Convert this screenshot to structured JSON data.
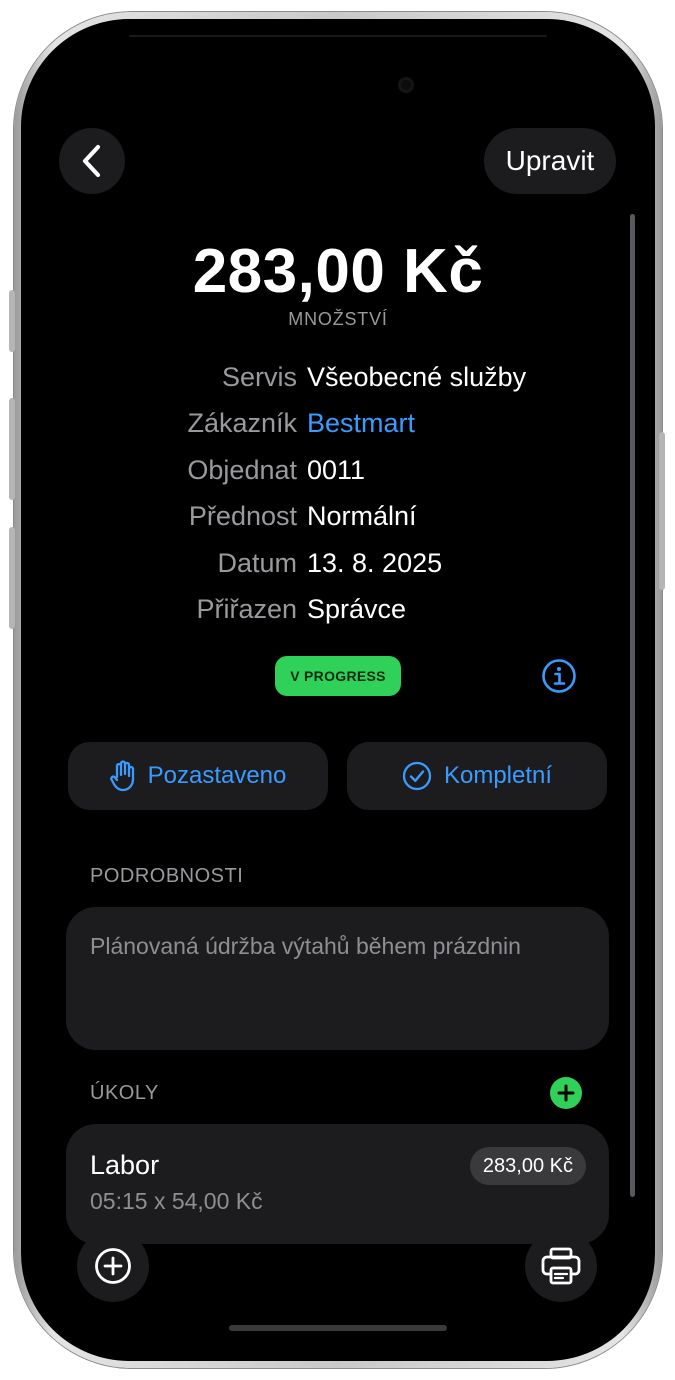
{
  "header": {
    "back_icon": "chevron-left-icon",
    "edit_label": "Upravit"
  },
  "summary": {
    "amount": "283,00 Kč",
    "amount_label": "MNOŽSTVÍ"
  },
  "details": [
    {
      "label": "Servis",
      "value": "Všeobecné služby"
    },
    {
      "label": "Zákazník",
      "value": "Bestmart"
    },
    {
      "label": "Objednat",
      "value": "0011"
    },
    {
      "label": "Přednost",
      "value": "Normální"
    },
    {
      "label": "Datum",
      "value": "13. 8. 2025"
    },
    {
      "label": "Přiřazen",
      "value": "Správce"
    }
  ],
  "status": {
    "badge": "V PROGRESS",
    "badge_color": "#30d158",
    "info_icon": "info-circle-icon"
  },
  "actions": {
    "pause_label": "Pozastaveno",
    "pause_icon": "hand-raised-icon",
    "complete_label": "Kompletní",
    "complete_icon": "checkmark-circle-icon",
    "accent_color": "#3a9bff"
  },
  "notes": {
    "header": "PODROBNOSTI",
    "text": "Plánovaná údržba výtahů během prázdnin"
  },
  "tasks": {
    "header": "ÚKOLY",
    "add_icon": "plus-circle-icon",
    "items": [
      {
        "title": "Labor",
        "subtitle": "05:15 x 54,00 Kč",
        "price": "283,00 Kč"
      }
    ]
  },
  "footer": {
    "add_icon": "plus-circle-icon",
    "print_icon": "printer-icon"
  }
}
